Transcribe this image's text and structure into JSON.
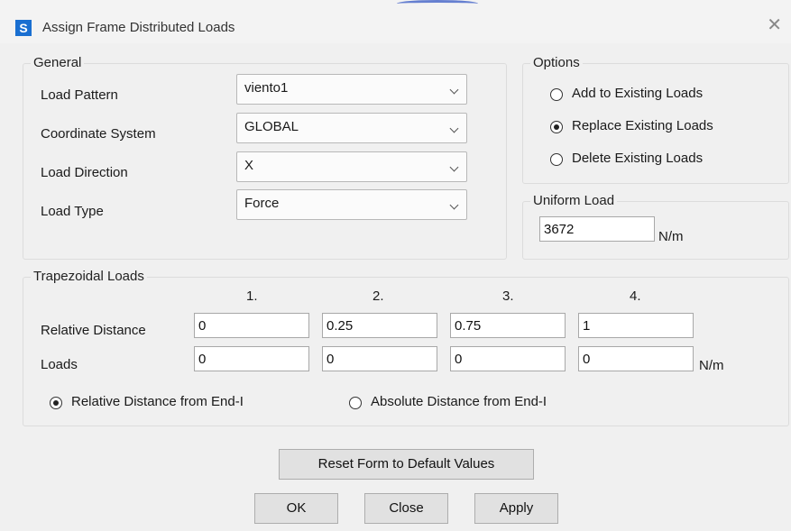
{
  "window": {
    "app_icon": "S",
    "title": "Assign Frame Distributed Loads",
    "close_glyph": "✕"
  },
  "general": {
    "label": "General",
    "rows": [
      {
        "label": "Load Pattern",
        "value": "viento1"
      },
      {
        "label": "Coordinate System",
        "value": "GLOBAL"
      },
      {
        "label": "Load Direction",
        "value": "X"
      },
      {
        "label": "Load Type",
        "value": "Force"
      }
    ]
  },
  "options": {
    "label": "Options",
    "choices": [
      {
        "label": "Add to Existing Loads",
        "selected": false
      },
      {
        "label": "Replace Existing Loads",
        "selected": true
      },
      {
        "label": "Delete Existing Loads",
        "selected": false
      }
    ]
  },
  "uniform": {
    "label": "Uniform Load",
    "value": "3672",
    "unit": "N/m"
  },
  "trapezoidal": {
    "label": "Trapezoidal Loads",
    "columns": [
      "1.",
      "2.",
      "3.",
      "4."
    ],
    "relative_distance_label": "Relative Distance",
    "relative_distance": [
      "0",
      "0.25",
      "0.75",
      "1"
    ],
    "loads_label": "Loads",
    "loads": [
      "0",
      "0",
      "0",
      "0"
    ],
    "unit": "N/m",
    "distance_mode": [
      {
        "label": "Relative Distance from End-I",
        "selected": true
      },
      {
        "label": "Absolute Distance from End-I",
        "selected": false
      }
    ]
  },
  "buttons": {
    "reset": "Reset Form to Default Values",
    "ok": "OK",
    "close": "Close",
    "apply": "Apply"
  }
}
